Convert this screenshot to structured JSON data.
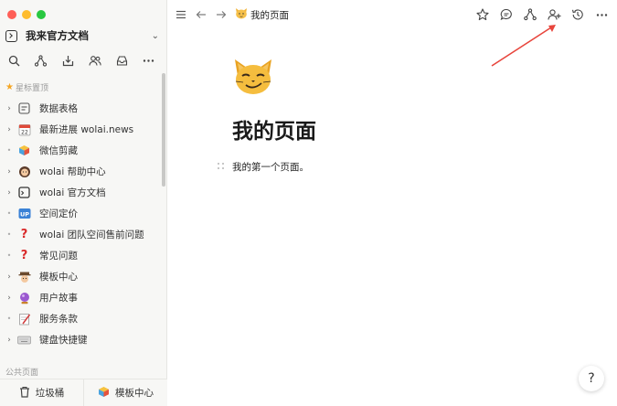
{
  "sidebar": {
    "workspace_name": "我来官方文档",
    "starred_label": "星标置顶",
    "public_label": "公共页面",
    "items": [
      {
        "label": "数据表格",
        "icon": "table-icon",
        "expandable": true
      },
      {
        "label": "最新进展 wolai.news",
        "icon": "calendar-icon",
        "expandable": true
      },
      {
        "label": "微信剪藏",
        "icon": "cube-icon",
        "expandable": false
      },
      {
        "label": "wolai 帮助中心",
        "icon": "person-icon",
        "expandable": true
      },
      {
        "label": "wolai 官方文档",
        "icon": "doc-icon",
        "expandable": true
      },
      {
        "label": "空间定价",
        "icon": "up-icon",
        "expandable": false
      },
      {
        "label": "wolai 团队空间售前问题",
        "icon": "question-icon",
        "expandable": false
      },
      {
        "label": "常见问题",
        "icon": "question-icon",
        "expandable": false
      },
      {
        "label": "模板中心",
        "icon": "detective-icon",
        "expandable": true
      },
      {
        "label": "用户故事",
        "icon": "crystal-ball-icon",
        "expandable": true
      },
      {
        "label": "服务条款",
        "icon": "pen-paper-icon",
        "expandable": false
      },
      {
        "label": "键盘快捷键",
        "icon": "keyboard-icon",
        "expandable": true
      }
    ],
    "bottom": {
      "trash_label": "垃圾桶",
      "templates_label": "模板中心"
    }
  },
  "topbar": {
    "breadcrumb_label": "我的页面",
    "breadcrumb_icon": "cat-face-icon"
  },
  "page": {
    "title": "我的页面",
    "icon": "smirking-cat-icon",
    "block_text": "我的第一个页面。"
  },
  "help": {
    "label": "?"
  },
  "colors": {
    "annotation_arrow": "#e8453c",
    "star": "#f5a623"
  }
}
